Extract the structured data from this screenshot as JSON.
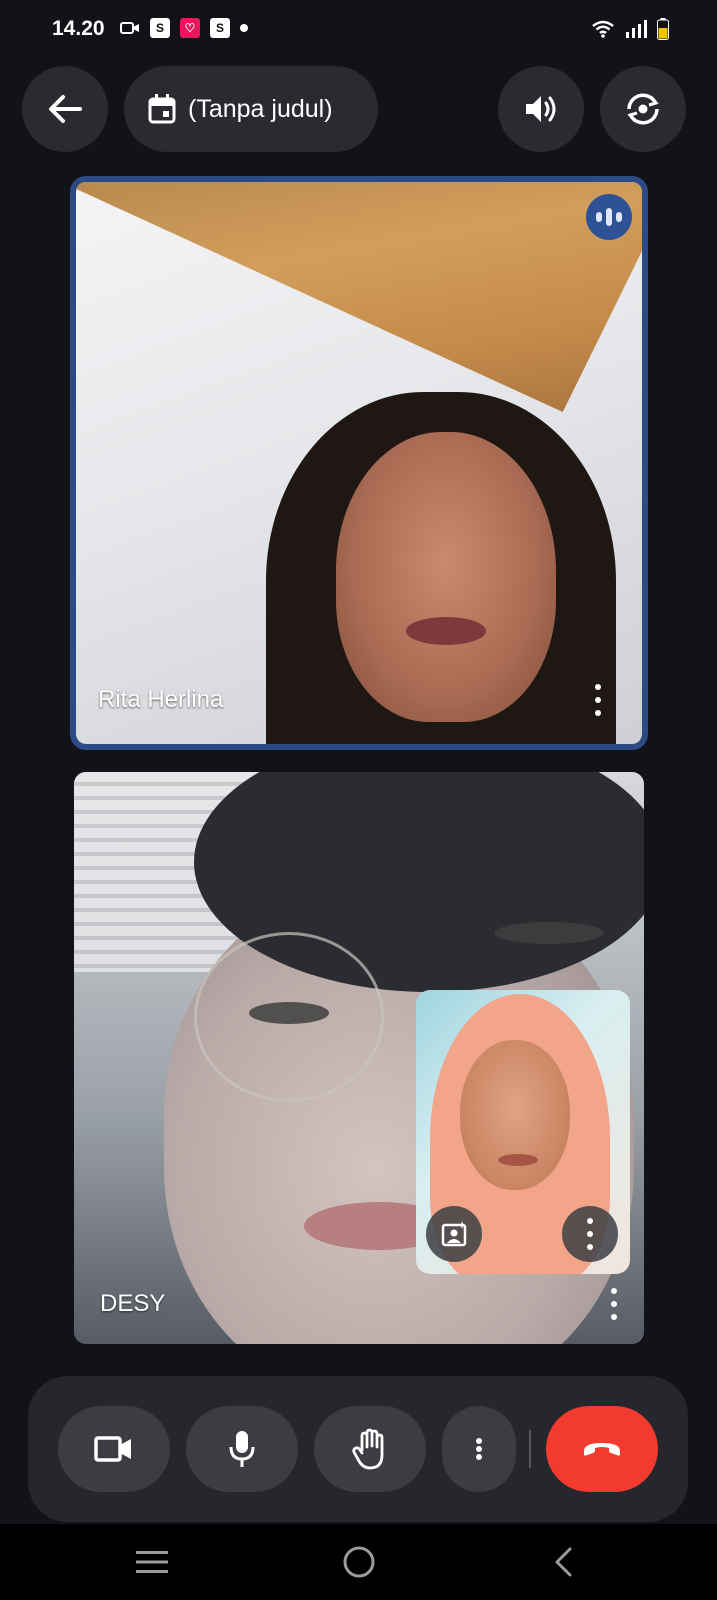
{
  "status_bar": {
    "time": "14.20",
    "left_icons": [
      "video-notification-icon",
      "shopee-icon",
      "pink-app-icon",
      "shopee-icon",
      "dot-indicator"
    ],
    "right_icons": [
      "wifi-icon",
      "signal-icon",
      "battery-icon"
    ],
    "battery_color": "#f5c400"
  },
  "header": {
    "title": "(Tanpa judul)"
  },
  "participants": {
    "rita": {
      "name": "Rita Herlina",
      "speaking": true
    },
    "desy": {
      "name": "DESY"
    }
  },
  "controls": {
    "buttons": [
      "camera",
      "microphone",
      "raise-hand",
      "more-options",
      "end-call"
    ],
    "end_call_color": "#f23a2f"
  },
  "navigation": {
    "items": [
      "recent-apps",
      "home",
      "back"
    ]
  },
  "colors": {
    "background": "#121318",
    "active_speaker_border": "#2c4a86",
    "speaking_badge": "#2f5296"
  }
}
